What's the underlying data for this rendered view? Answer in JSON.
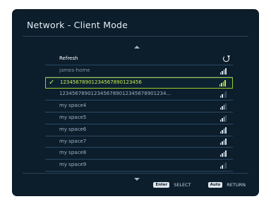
{
  "header": {
    "title": "Network - Client Mode"
  },
  "list": {
    "refresh_label": "Refresh",
    "items": [
      {
        "label": "james-home",
        "signal": 4,
        "state": "normal"
      },
      {
        "label": "12345678901234567890123456",
        "signal": 4,
        "state": "selected"
      },
      {
        "label": "1234567890123456789012345678901234...",
        "signal": 2,
        "state": "normal"
      },
      {
        "label": "my space4",
        "signal": 3,
        "state": "normal"
      },
      {
        "label": "my space5",
        "signal": 3,
        "state": "normal"
      },
      {
        "label": "my space6",
        "signal": 4,
        "state": "normal"
      },
      {
        "label": "my space7",
        "signal": 4,
        "state": "normal"
      },
      {
        "label": "my space8",
        "signal": 4,
        "state": "normal"
      },
      {
        "label": "my space9",
        "signal": 2,
        "state": "normal"
      }
    ]
  },
  "footer": {
    "enter_key": "Enter",
    "select_label": "SELECT",
    "auto_key": "Auto",
    "return_label": "RETURN"
  },
  "colors": {
    "background": "#0c1d2b",
    "accent": "#c8ec53",
    "selection_border": "#9acd32"
  }
}
